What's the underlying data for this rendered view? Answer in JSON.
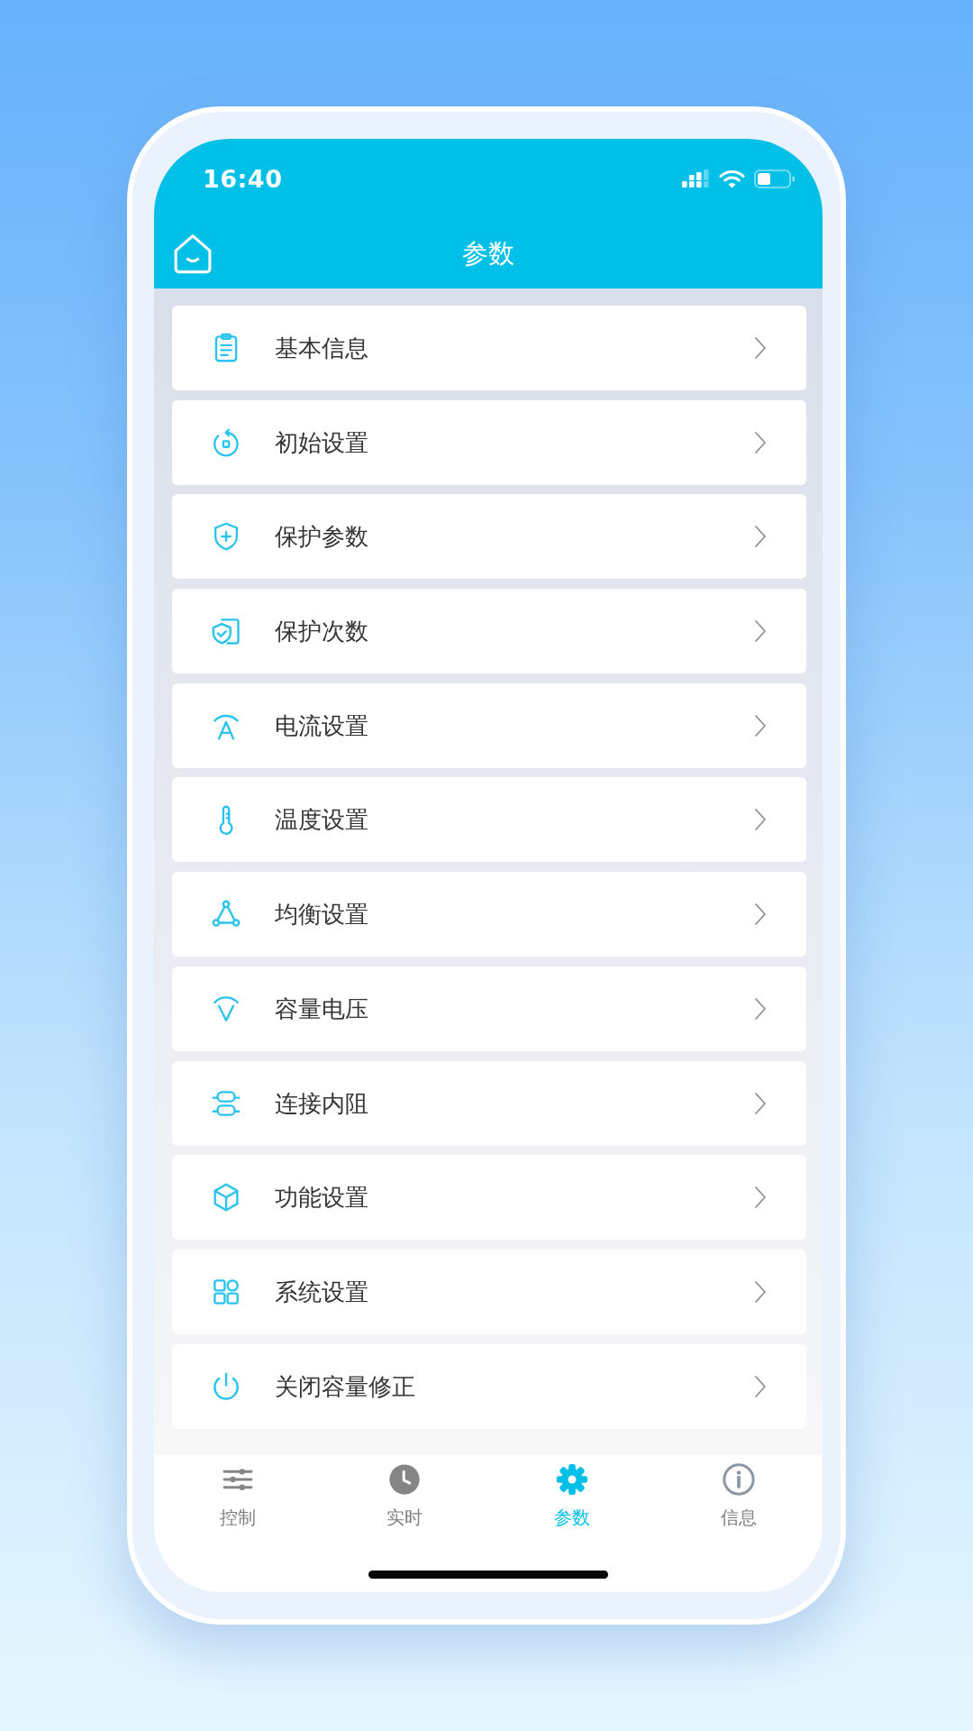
{
  "status_bar": {
    "time": "16:40"
  },
  "header": {
    "title": "参数"
  },
  "menu": [
    {
      "label": "基本信息"
    },
    {
      "label": "初始设置"
    },
    {
      "label": "保护参数"
    },
    {
      "label": "保护次数"
    },
    {
      "label": "电流设置"
    },
    {
      "label": "温度设置"
    },
    {
      "label": "均衡设置"
    },
    {
      "label": "容量电压"
    },
    {
      "label": "连接内阻"
    },
    {
      "label": "功能设置"
    },
    {
      "label": "系统设置"
    },
    {
      "label": "关闭容量修正"
    }
  ],
  "tab_bar": [
    {
      "label": "控制",
      "selected": false
    },
    {
      "label": "实时",
      "selected": false
    },
    {
      "label": "参数",
      "selected": true
    },
    {
      "label": "信息",
      "selected": false
    }
  ]
}
